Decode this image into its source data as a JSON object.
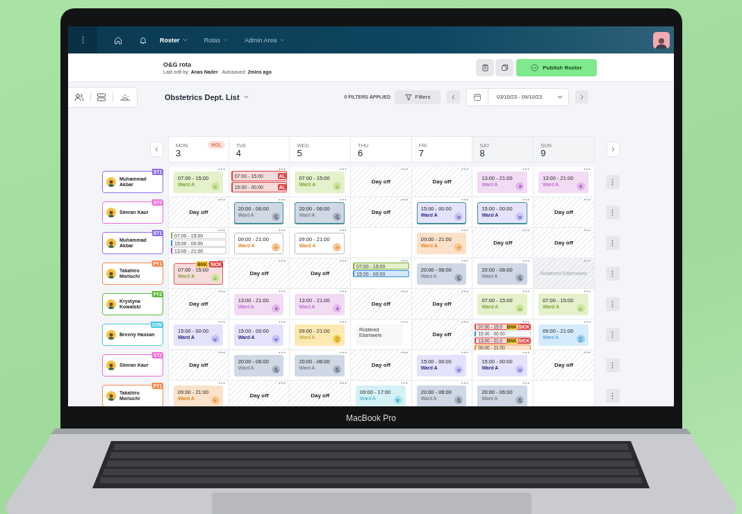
{
  "nav": {
    "items": [
      {
        "label": "Roster",
        "selected": true
      },
      {
        "label": "Rotas",
        "selected": false
      },
      {
        "label": "Admin Area",
        "selected": false
      }
    ]
  },
  "header": {
    "title": "O&G rota",
    "last_edit_label": "Last edit by:",
    "last_edit_by": "Anas Nader",
    "autosaved_label": "Autosaved:",
    "autosaved": "2mins ago",
    "publish_button": "Publish Roster"
  },
  "toolbar": {
    "list_title": "Obstetrics Dept. List",
    "filters_applied": "0 FILTERS APPLIED",
    "filters_button": "Filters",
    "date_range": "03/10/23 - 09/10/23"
  },
  "days": [
    {
      "weekday": "MON",
      "date": "3",
      "badge": "HOL",
      "weekend": false
    },
    {
      "weekday": "TUE",
      "date": "4",
      "weekend": false
    },
    {
      "weekday": "WED",
      "date": "5",
      "weekend": false
    },
    {
      "weekday": "THU",
      "date": "6",
      "weekend": false
    },
    {
      "weekday": "FRI",
      "date": "7",
      "weekend": false
    },
    {
      "weekday": "SAT",
      "date": "8",
      "weekend": true
    },
    {
      "weekday": "SUN",
      "date": "9",
      "weekend": true
    }
  ],
  "rows": [
    {
      "name": "Muhammad Akbar",
      "grade": "ST1",
      "color": "#8b6cf0",
      "cells": [
        {
          "kind": "day",
          "time": "07:00 - 15:00",
          "ward": "Ward A",
          "selected": false
        },
        {
          "kind": "multi",
          "lines": [
            {
              "time": "07:00 - 15:00",
              "kind": "leave",
              "filled": true,
              "tags": [
                {
                  "label": "AL",
                  "kind": "leave"
                }
              ]
            },
            {
              "time": "15:00 - 00:00",
              "kind": "leave",
              "filled": true,
              "tags": [
                {
                  "label": "AL",
                  "kind": "leave"
                }
              ]
            }
          ]
        },
        {
          "kind": "day",
          "time": "07:00 - 15:00",
          "ward": "Ward A",
          "selected": false
        },
        {
          "kind": "off",
          "label": "Day off"
        },
        {
          "kind": "off",
          "label": "Day off"
        },
        {
          "kind": "late",
          "time": "13:00 - 21:00",
          "ward": "Ward A",
          "selected": false
        },
        {
          "kind": "late",
          "time": "13:00 - 21:00",
          "ward": "Ward A",
          "selected": false
        }
      ]
    },
    {
      "name": "Simran Kaur",
      "grade": "ST2",
      "color": "#f06ad8",
      "cells": [
        {
          "kind": "off",
          "label": "Day off"
        },
        {
          "kind": "night",
          "time": "20:00 - 06:00",
          "ward": "Ward A",
          "selected": true
        },
        {
          "kind": "night",
          "time": "20:00 - 06:00",
          "ward": "Ward A",
          "selected": true
        },
        {
          "kind": "off",
          "label": "Day off"
        },
        {
          "kind": "evening",
          "time": "15:00 - 00:00",
          "ward": "Ward A",
          "selected": true
        },
        {
          "kind": "evening",
          "time": "15:00 - 00:00",
          "ward": "Ward A",
          "selected": true
        },
        {
          "kind": "off",
          "label": "Day off"
        }
      ]
    },
    {
      "name": "Muhammad Akbar",
      "grade": "ST1",
      "color": "#8b6cf0",
      "cells": [
        {
          "kind": "multi",
          "lines": [
            {
              "time": "07:00 - 15:00",
              "kind": "day",
              "filled": false
            },
            {
              "time": "15:00 - 00:00",
              "kind": "evening",
              "filled": false
            },
            {
              "time": "13:00 - 21:00",
              "kind": "late",
              "filled": false
            }
          ]
        },
        {
          "kind": "long-open",
          "time": "09:00 - 21:00",
          "ward": "Ward A",
          "selected": false
        },
        {
          "kind": "long-open",
          "time": "09:00 - 21:00",
          "ward": "Ward A",
          "selected": false
        },
        {
          "kind": "empty"
        },
        {
          "kind": "long",
          "time": "09:00 - 21:00",
          "ward": "Ward A",
          "selected": false
        },
        {
          "kind": "off",
          "label": "Day off"
        },
        {
          "kind": "off",
          "label": "Day off"
        }
      ]
    },
    {
      "name": "Takahiro Moriuchi",
      "grade": "FY1",
      "color": "#f5874a",
      "cells": [
        {
          "kind": "day-sick",
          "time": "07:00 - 15:00",
          "ward": "Ward A",
          "selected": false,
          "tags": [
            {
              "label": "BNK",
              "kind": "bank"
            },
            {
              "label": "SICK",
              "kind": "sick"
            }
          ]
        },
        {
          "kind": "off",
          "label": "Day off"
        },
        {
          "kind": "off",
          "label": "Day off"
        },
        {
          "kind": "multi",
          "lines": [
            {
              "time": "07:00 - 15:00",
              "kind": "day",
              "filled": true
            },
            {
              "time": "15:00 - 00:00",
              "kind": "evening",
              "filled": true
            }
          ]
        },
        {
          "kind": "night",
          "time": "20:00 - 06:00",
          "ward": "Ward A",
          "selected": false
        },
        {
          "kind": "night",
          "time": "20:00 - 06:00",
          "ward": "Ward A",
          "selected": false
        },
        {
          "kind": "rostered",
          "label": "Rostered Elsehwere"
        }
      ]
    },
    {
      "name": "Krystyna Kowalski",
      "grade": "FY2",
      "color": "#5cb83a",
      "cells": [
        {
          "kind": "off",
          "label": "Day off"
        },
        {
          "kind": "late",
          "time": "13:00 - 21:00",
          "ward": "Ward A",
          "selected": false
        },
        {
          "kind": "late",
          "time": "13:00 - 21:00",
          "ward": "Ward A",
          "selected": false
        },
        {
          "kind": "off",
          "label": "Day off"
        },
        {
          "kind": "off",
          "label": "Day off"
        },
        {
          "kind": "day",
          "time": "07:00 - 15:00",
          "ward": "Ward A",
          "selected": false
        },
        {
          "kind": "day",
          "time": "07:00 - 15:00",
          "ward": "Ward A",
          "selected": false
        }
      ]
    },
    {
      "name": "Breeny Hassan",
      "grade": "CON",
      "color": "#4cc6e6",
      "cells": [
        {
          "kind": "evening",
          "time": "15:00 - 00:00",
          "ward": "Ward A",
          "selected": false
        },
        {
          "kind": "evening",
          "time": "15:00 - 00:00",
          "ward": "Ward A",
          "selected": false
        },
        {
          "kind": "oncall",
          "time": "09:00 - 21:00",
          "ward": "Ward A",
          "selected": false
        },
        {
          "kind": "external",
          "label": "Rostered Elsehwere"
        },
        {
          "kind": "off",
          "label": "Day off"
        },
        {
          "kind": "multi",
          "lines": [
            {
              "time": "07:00 - 15:0",
              "kind": "leave",
              "filled": true,
              "tags": [
                {
                  "label": "BNK",
                  "kind": "bank"
                },
                {
                  "label": "SICK",
                  "kind": "sick"
                }
              ]
            },
            {
              "time": "15:00 - 00:00",
              "kind": "evening",
              "filled": false
            },
            {
              "time": "13:00 - 21:0",
              "kind": "leave",
              "filled": true,
              "tags": [
                {
                  "label": "BNK",
                  "kind": "bank"
                },
                {
                  "label": "SICK",
                  "kind": "sick"
                }
              ]
            },
            {
              "time": "09:00 - 21:00",
              "kind": "long",
              "filled": true
            }
          ]
        },
        {
          "kind": "blue",
          "time": "09:00 - 21:00",
          "ward": "Ward A",
          "selected": false
        }
      ]
    },
    {
      "name": "Simran Kaur",
      "grade": "ST2",
      "color": "#f06ad8",
      "cells": [
        {
          "kind": "off",
          "label": "Day off"
        },
        {
          "kind": "night",
          "time": "20:00 - 06:00",
          "ward": "Ward A",
          "selected": false
        },
        {
          "kind": "night",
          "time": "20:00 - 06:00",
          "ward": "Ward A",
          "selected": false
        },
        {
          "kind": "off",
          "label": "Day off"
        },
        {
          "kind": "evening",
          "time": "15:00 - 00:00",
          "ward": "Ward A",
          "selected": false
        },
        {
          "kind": "evening",
          "time": "15:00 - 00:00",
          "ward": "Ward A",
          "selected": false
        },
        {
          "kind": "off",
          "label": "Day off"
        }
      ]
    },
    {
      "name": "Takahiro Moriuchi",
      "grade": "FY1",
      "color": "#f5874a",
      "cells": [
        {
          "kind": "long",
          "time": "09:00 - 21:00",
          "ward": "Ward A",
          "selected": false
        },
        {
          "kind": "off",
          "label": "Day off"
        },
        {
          "kind": "off",
          "label": "Day off"
        },
        {
          "kind": "cyan",
          "time": "09:00 - 17:00",
          "ward": "Ward A",
          "selected": false
        },
        {
          "kind": "night",
          "time": "20:00 - 06:00",
          "ward": "Ward A",
          "selected": false
        },
        {
          "kind": "night",
          "time": "20:00 - 06:00",
          "ward": "Ward A",
          "selected": false
        },
        {
          "kind": "empty"
        }
      ]
    }
  ],
  "device": {
    "label": "MacBook Pro"
  }
}
